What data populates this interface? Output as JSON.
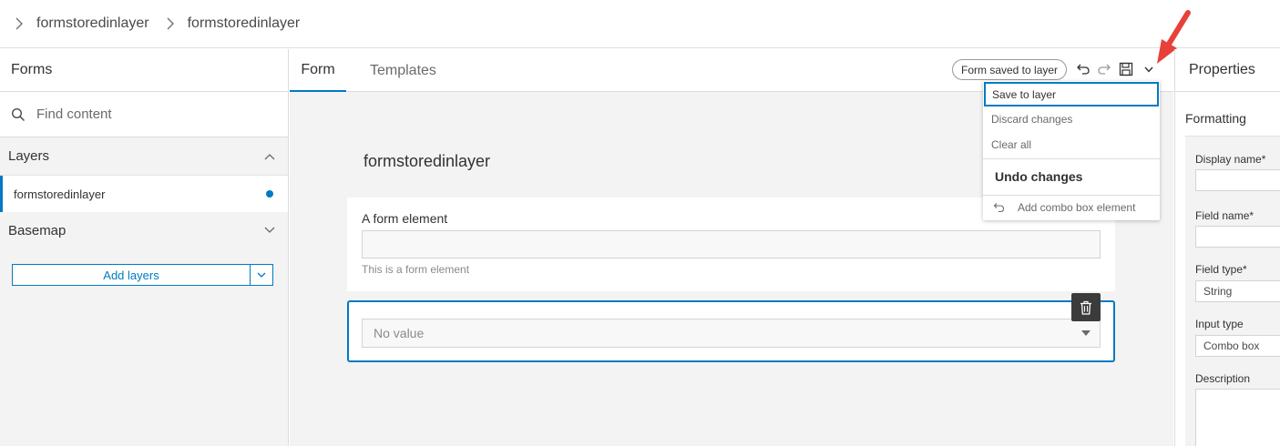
{
  "breadcrumb": {
    "items": [
      "formstoredinlayer",
      "formstoredinlayer"
    ]
  },
  "left_panel": {
    "title": "Forms",
    "search_placeholder": "Find content",
    "layers_section": "Layers",
    "layer_item": "formstoredinlayer",
    "basemap_section": "Basemap",
    "add_layers_label": "Add layers"
  },
  "tabs": {
    "form": "Form",
    "templates": "Templates"
  },
  "toolbar": {
    "status": "Form saved to layer"
  },
  "menu": {
    "save_to_layer": "Save to layer",
    "discard_changes": "Discard changes",
    "clear_all": "Clear all",
    "undo_header": "Undo changes",
    "undo_item": "Add combo box element"
  },
  "canvas": {
    "form_title": "formstoredinlayer",
    "element_label": "A form element",
    "element_hint": "This is a form element",
    "combo_placeholder": "No value"
  },
  "properties": {
    "title": "Properties",
    "formatting": "Formatting",
    "display_name_label": "Display name*",
    "field_name_label": "Field name*",
    "field_type_label": "Field type*",
    "field_type_value": "String",
    "input_type_label": "Input type",
    "input_type_value": "Combo box",
    "description_label": "Description"
  },
  "colors": {
    "accent": "#007ac2",
    "annotation_arrow": "#e8403a"
  }
}
